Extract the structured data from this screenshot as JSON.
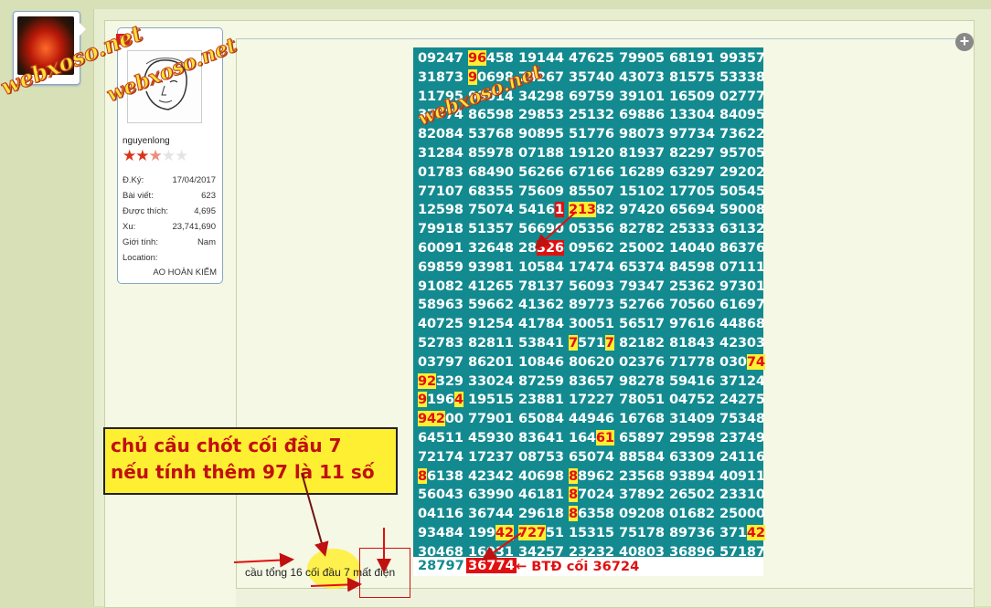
{
  "avatar": {
    "name": "avatar"
  },
  "user": {
    "badge": "Đ",
    "username": "nguyenlong",
    "rating": {
      "filled": 2.5,
      "max": 5
    },
    "fields": [
      {
        "label": "Đ.Ký:",
        "value": "17/04/2017"
      },
      {
        "label": "Bài viết:",
        "value": "623"
      },
      {
        "label": "Được thích:",
        "value": "4,695"
      },
      {
        "label": "Xu:",
        "value": "23,741,690"
      },
      {
        "label": "Giới tính:",
        "value": "Nam"
      },
      {
        "label": "Location:",
        "value": ""
      }
    ],
    "location": "AO HOÀN KIẾM"
  },
  "watermarks": [
    "webxoso.net",
    "webxoso.net",
    "webxoso.net"
  ],
  "grid_rows": [
    "09247 96458 19144 47625 79905 68191 99357",
    "31873 90698 74267 35740 43073 81575 53338",
    "11795 93014 34298 69759 39101 16509 02777",
    "37374 86598 29853 25132 69886 13304 84095",
    "82084 53768 90895 51776 98073 97734 73622",
    "31284 85978 07188 19120 81937 82297 95705",
    "01783 68490 56266 67166 16289 63297 29202",
    "77107 68355 75609 85507 15102 17705 50545",
    "12598 75074 54161 21382 97420 65694 59008",
    "79918 51357 56690 05356 82782 25333 63132",
    "60091 32648 28326 09562 25002 14040 86376",
    "69859 93981 10584 17474 65374 84598 07111",
    "91082 41265 78137 56093 79347 25362 97301",
    "58963 59662 41362 89773 52766 70560 61697",
    "40725 91254 41784 30051 56517 97616 44868",
    "52783 82811 53841 75717 82182 81843 42303",
    "03797 86201 10846 80620 02376 71778 03074",
    "92329 33024 87259 83657 98278 59416 37124",
    "91964 19515 23881 17227 78051 04752 24275",
    "94200 77901 65084 44946 16768 31409 75348",
    "64511 45930 83641 16461 65897 29598 23749",
    "72174 17237 08753 65074 88584 63309 24116",
    "86138 42342 40698 88962 23568 93894 40911",
    "56043 63990 46181 87024 37892 26502 23310",
    "04116 36744 29618 86358 09208 01682 25000",
    "93484 19942 72751 15315 75178 89736 37142",
    "30468 16031 34257 23232 40803 36896 57187"
  ],
  "grid_last": {
    "first": "28797",
    "btd": "36774",
    "label": "← BTĐ cối 36724"
  },
  "note": {
    "line1": "chủ cầu chốt cối đầu 7",
    "line2": "nếu tính thêm 97 là 11 số"
  },
  "caption": "cầu tổng 16 cối đầu 7 mất điện",
  "icons": {
    "expand": "expand-icon"
  }
}
